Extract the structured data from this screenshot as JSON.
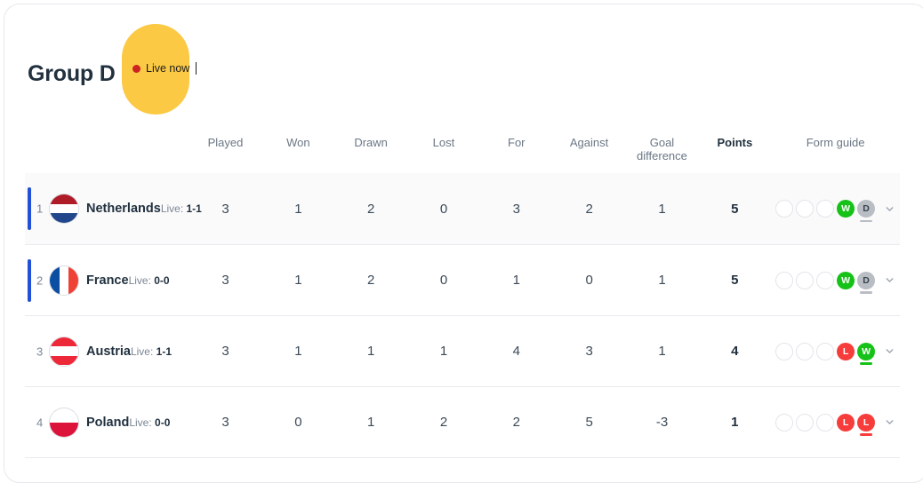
{
  "header": {
    "group_title": "Group D",
    "live_badge": {
      "label": "Live now",
      "dot_color": "#cc2222",
      "background": "#fbc944"
    }
  },
  "table": {
    "columns": [
      {
        "key": "team",
        "label": ""
      },
      {
        "key": "played",
        "label": "Played"
      },
      {
        "key": "won",
        "label": "Won"
      },
      {
        "key": "drawn",
        "label": "Drawn"
      },
      {
        "key": "lost",
        "label": "Lost"
      },
      {
        "key": "for",
        "label": "For"
      },
      {
        "key": "against",
        "label": "Against"
      },
      {
        "key": "gd",
        "label": "Goal difference"
      },
      {
        "key": "points",
        "label": "Points"
      },
      {
        "key": "form",
        "label": "Form guide"
      }
    ],
    "rows": [
      {
        "rank": "1",
        "team": "Netherlands",
        "live_label": "Live:",
        "live_score": "1-1",
        "played": "3",
        "won": "1",
        "drawn": "2",
        "lost": "0",
        "for": "3",
        "against": "2",
        "gd": "1",
        "points": "5",
        "qualifying": true,
        "highlight": true,
        "flag": "netherlands",
        "form": [
          "",
          "",
          "",
          "W",
          "D"
        ],
        "form_current_index": 4
      },
      {
        "rank": "2",
        "team": "France",
        "live_label": "Live:",
        "live_score": "0-0",
        "played": "3",
        "won": "1",
        "drawn": "2",
        "lost": "0",
        "for": "1",
        "against": "0",
        "gd": "1",
        "points": "5",
        "qualifying": true,
        "highlight": false,
        "flag": "france",
        "form": [
          "",
          "",
          "",
          "W",
          "D"
        ],
        "form_current_index": 4
      },
      {
        "rank": "3",
        "team": "Austria",
        "live_label": "Live:",
        "live_score": "1-1",
        "played": "3",
        "won": "1",
        "drawn": "1",
        "lost": "1",
        "for": "4",
        "against": "3",
        "gd": "1",
        "points": "4",
        "qualifying": false,
        "highlight": false,
        "flag": "austria",
        "form": [
          "",
          "",
          "",
          "L",
          "W"
        ],
        "form_current_index": 4
      },
      {
        "rank": "4",
        "team": "Poland",
        "live_label": "Live:",
        "live_score": "0-0",
        "played": "3",
        "won": "0",
        "drawn": "1",
        "lost": "2",
        "for": "2",
        "against": "5",
        "gd": "-3",
        "points": "1",
        "qualifying": false,
        "highlight": false,
        "flag": "poland",
        "form": [
          "",
          "",
          "",
          "L",
          "L"
        ],
        "form_current_index": 4
      }
    ]
  },
  "colors": {
    "qualify_bar": "#2250d6",
    "win": "#16c217",
    "loss": "#f73c3c",
    "draw": "#b9bec4",
    "title": "#22313f",
    "muted": "#6b7785"
  },
  "icons": {
    "expand": "chevron-down-icon"
  }
}
